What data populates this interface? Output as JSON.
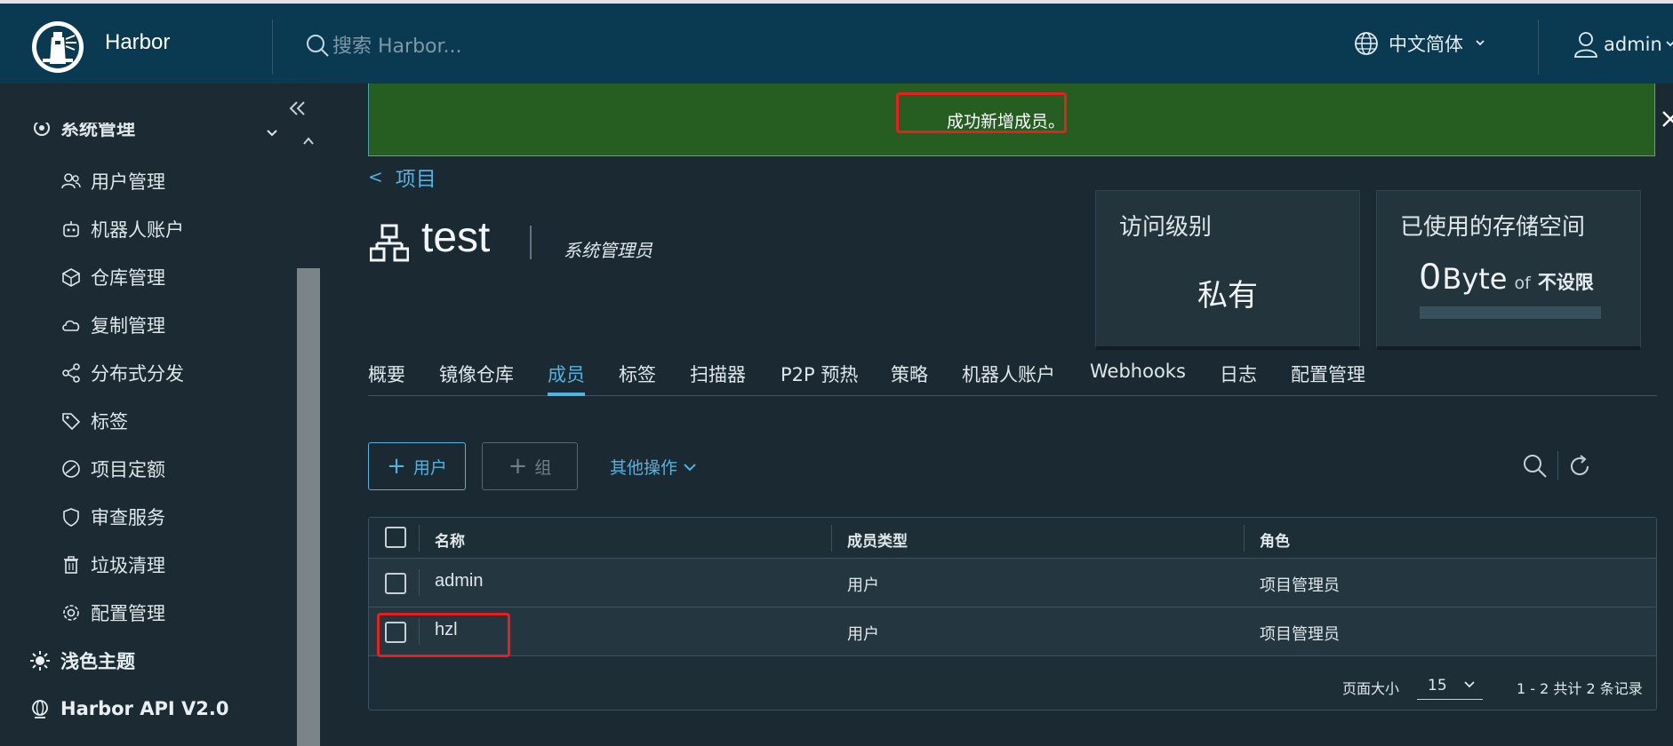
{
  "header": {
    "brand": "Harbor",
    "search_placeholder": "搜索 Harbor...",
    "language": "中文简体",
    "user": "admin"
  },
  "sidebar": {
    "group_label": "系统管理",
    "items": [
      {
        "label": "用户管理",
        "icon": "users-icon"
      },
      {
        "label": "机器人账户",
        "icon": "robot-icon"
      },
      {
        "label": "仓库管理",
        "icon": "cube-icon"
      },
      {
        "label": "复制管理",
        "icon": "cloud-icon"
      },
      {
        "label": "分布式分发",
        "icon": "share-icon"
      },
      {
        "label": "标签",
        "icon": "tag-icon"
      },
      {
        "label": "项目定额",
        "icon": "gauge-icon"
      },
      {
        "label": "审查服务",
        "icon": "shield-icon"
      },
      {
        "label": "垃圾清理",
        "icon": "trash-icon"
      },
      {
        "label": "配置管理",
        "icon": "gear-icon"
      }
    ],
    "theme_label": "浅色主题",
    "api_label": "Harbor API V2.0"
  },
  "alert": {
    "message": "成功新增成员。"
  },
  "breadcrumb": {
    "label": "项目"
  },
  "project": {
    "name": "test",
    "role": "系统管理员"
  },
  "cards": {
    "access": {
      "title": "访问级别",
      "value": "私有"
    },
    "storage": {
      "title": "已使用的存储空间",
      "value": "0",
      "unit": "Byte",
      "of": "of",
      "limit": "不设限",
      "used_fraction": 0
    }
  },
  "tabs": [
    {
      "label": "概要"
    },
    {
      "label": "镜像仓库"
    },
    {
      "label": "成员",
      "active": true
    },
    {
      "label": "标签"
    },
    {
      "label": "扫描器"
    },
    {
      "label": "P2P 预热"
    },
    {
      "label": "策略"
    },
    {
      "label": "机器人账户"
    },
    {
      "label": "Webhooks"
    },
    {
      "label": "日志"
    },
    {
      "label": "配置管理"
    }
  ],
  "toolbar": {
    "add_user": "用户",
    "add_group": "组",
    "more_ops": "其他操作"
  },
  "table": {
    "columns": [
      "名称",
      "成员类型",
      "角色"
    ],
    "rows": [
      {
        "name": "admin",
        "type": "用户",
        "role": "项目管理员"
      },
      {
        "name": "hzl",
        "type": "用户",
        "role": "项目管理员"
      }
    ]
  },
  "pagination": {
    "page_size_label": "页面大小",
    "page_size": "15",
    "summary": "1 - 2 共计 2 条记录"
  },
  "colors": {
    "header_bg": "#0a3a52",
    "accent": "#4fb3e3",
    "success_bg": "#265e22",
    "highlight": "#e81f1f"
  }
}
